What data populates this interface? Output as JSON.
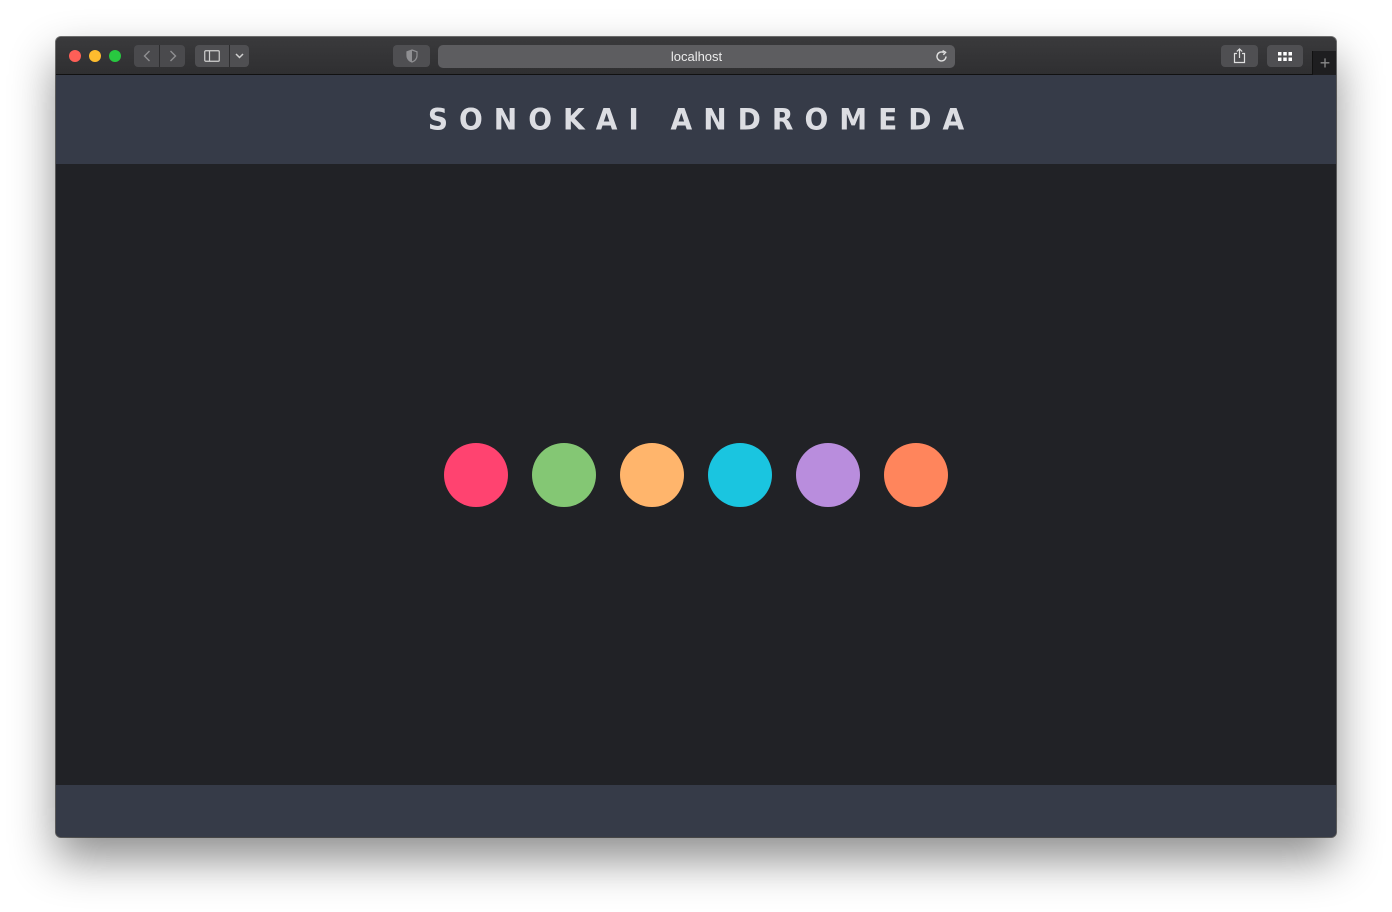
{
  "browser": {
    "address": "localhost",
    "new_tab_symbol": "+"
  },
  "header": {
    "title": "SONOKAI ANDROMEDA"
  },
  "palette": {
    "swatches": [
      {
        "name": "red",
        "color": "#ff4370"
      },
      {
        "name": "green",
        "color": "#84c774"
      },
      {
        "name": "yellow",
        "color": "#ffb56c"
      },
      {
        "name": "cyan",
        "color": "#1ac5e0"
      },
      {
        "name": "purple",
        "color": "#b98ddd"
      },
      {
        "name": "orange",
        "color": "#ff855c"
      }
    ]
  },
  "colors": {
    "background": "#212226",
    "header_footer": "#363b48",
    "title_text": "#dcdde2"
  },
  "icons": {
    "close": "close-button",
    "minimize": "minimize-button",
    "zoom": "zoom-button",
    "back": "chevron-left-icon",
    "forward": "chevron-right-icon",
    "sidebar": "sidebar-icon",
    "dropdown": "chevron-down-icon",
    "privacy": "shield-icon",
    "reload": "reload-icon",
    "share": "share-icon",
    "tabs": "tab-overview-icon"
  }
}
